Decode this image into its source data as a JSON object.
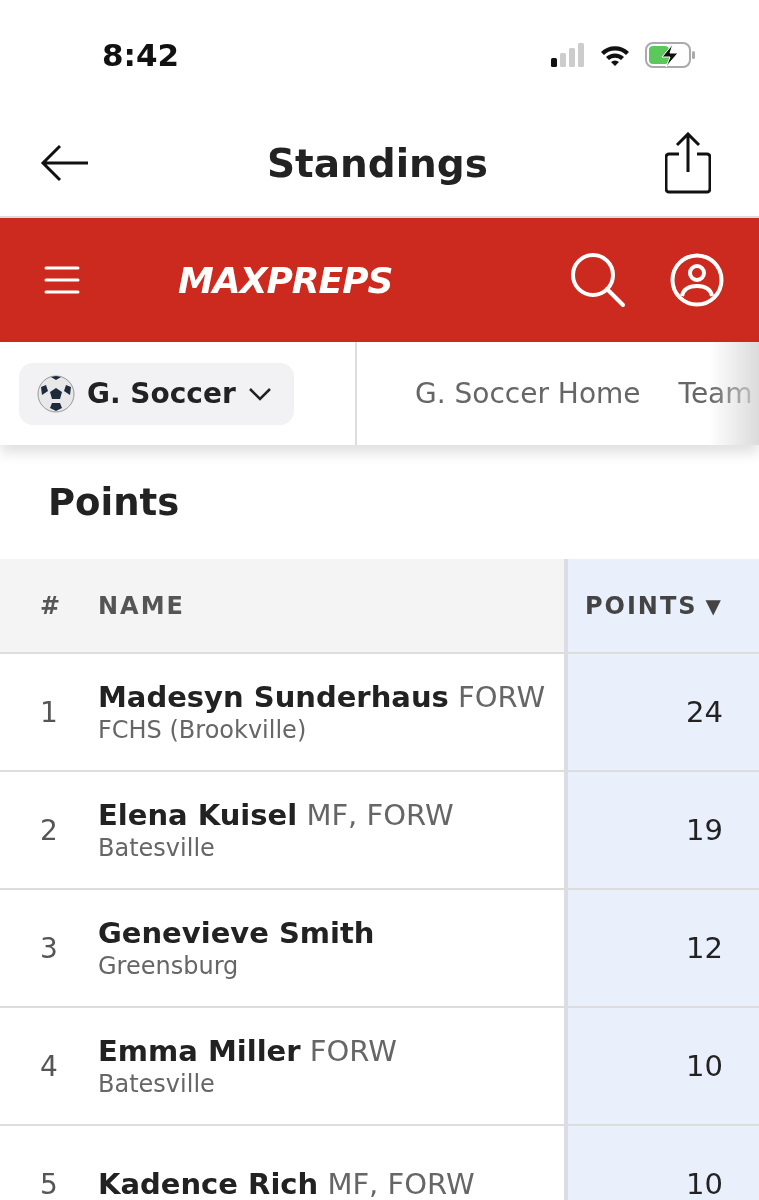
{
  "status_bar": {
    "time": "8:42"
  },
  "nav_bar": {
    "title": "Standings"
  },
  "brand_bar": {
    "logo": "MAXPREPS"
  },
  "sport_bar": {
    "sport": "G. Soccer",
    "links": [
      "G. Soccer Home",
      "Team"
    ]
  },
  "section_title": "Points",
  "table": {
    "columns": [
      {
        "label": "#",
        "sorted": false
      },
      {
        "label": "NAME",
        "sorted": false
      },
      {
        "label": "POINTS",
        "sorted": true,
        "sort_indicator": "▼"
      }
    ],
    "rows": [
      {
        "rank": "1",
        "name": "Madesyn Sunderhaus",
        "position": "FORW",
        "school": "FCHS (Brookville)",
        "points": "24"
      },
      {
        "rank": "2",
        "name": "Elena Kuisel",
        "position": "MF, FORW",
        "school": "Batesville",
        "points": "19"
      },
      {
        "rank": "3",
        "name": "Genevieve Smith",
        "school": "Greensburg",
        "points": "12"
      },
      {
        "rank": "4",
        "name": "Emma Miller",
        "position": "FORW",
        "school": "Batesville",
        "points": "10"
      },
      {
        "rank": "5",
        "name": "Kadence Rich",
        "position": "MF, FORW",
        "points": "10"
      }
    ]
  }
}
